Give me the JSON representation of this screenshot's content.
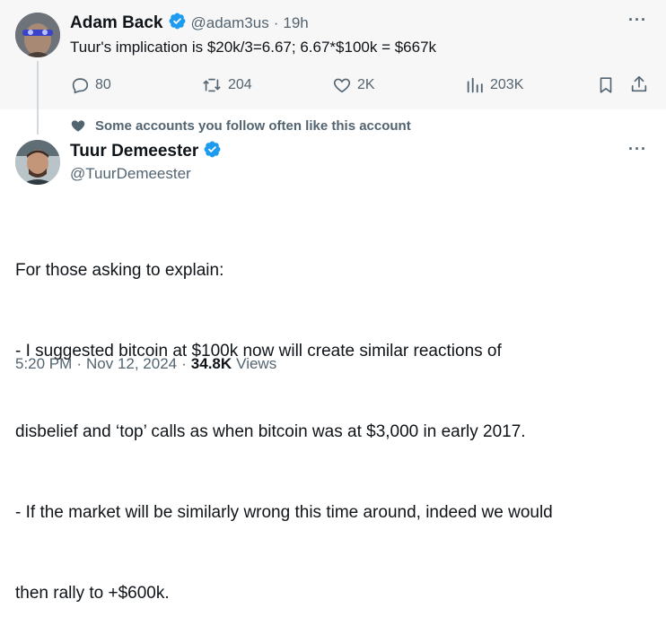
{
  "quoted_tweet": {
    "display_name": "Adam Back",
    "handle": "@adam3us",
    "separator": "·",
    "time_ago": "19h",
    "text": "Tuur's implication is $20k/3=6.67; 6.67*$100k = $667k",
    "actions": {
      "replies": "80",
      "reposts": "204",
      "likes": "2K",
      "views": "203K"
    }
  },
  "social_context": "Some accounts you follow often like this account",
  "main_tweet": {
    "display_name": "Tuur Demeester",
    "handle": "@TuurDemeester",
    "lines": [
      "For those asking to explain:",
      "- I suggested bitcoin at $100k now will create similar reactions of",
      "disbelief and ‘top’ calls as when bitcoin was at $3,000 in early 2017.",
      "- If the market will be similarly wrong this time around, indeed we would",
      "then rally to +$600k."
    ],
    "time": "5:20 PM",
    "date": "Nov 12, 2024",
    "separator": "·",
    "views_count": "34.8K",
    "views_label": "Views"
  },
  "colors": {
    "verified": "#1d9bf0",
    "muted": "#536471",
    "text": "#0f1419",
    "top_bg": "#f7f7f7"
  }
}
